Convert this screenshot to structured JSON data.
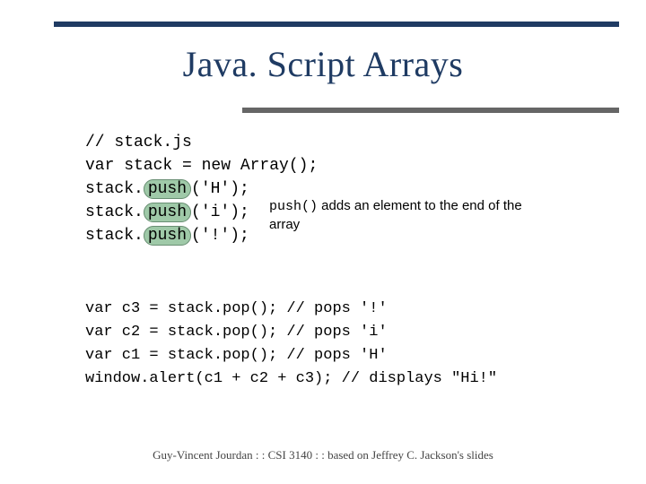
{
  "title": "Java. Script Arrays",
  "code": {
    "l1": "// stack.js",
    "l2": "var stack = new Array();",
    "l3a": "stack.",
    "l3b": "push",
    "l3c": "('H');",
    "l4a": "stack.",
    "l4b": "push",
    "l4c": "('i');",
    "l5a": "stack.",
    "l5b": "push",
    "l5c": "('!');",
    "u1": "var c3 = stack.pop(); // pops '!'",
    "u2": "var c2 = stack.pop(); // pops 'i'",
    "u3": "var c1 = stack.pop(); // pops 'H'",
    "u4": "window.alert(c1 + c2 + c3); // displays \"Hi!\""
  },
  "callout": {
    "mono": "push()",
    "rest": " adds an element to the end of the array"
  },
  "footer": "Guy-Vincent Jourdan : : CSI 3140 : : based on Jeffrey C. Jackson's slides"
}
